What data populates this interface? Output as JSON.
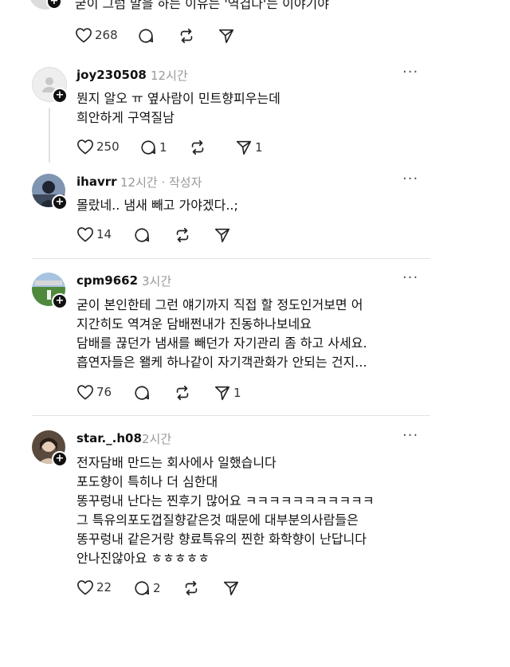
{
  "top_partial": {
    "text": "굳이 그럼 말을 하는 이유는 '역겹다'는 이야기야",
    "actions": {
      "like_count": "268"
    }
  },
  "comments": [
    {
      "username": "joy230508",
      "time": "12시간",
      "lines": [
        "뭔지 알오 ㅠ 옆사람이 민트향피우는데",
        "희안하게 구역질남"
      ],
      "actions": {
        "like_count": "250",
        "comment_count": "1",
        "share_count": "1"
      }
    },
    {
      "username": "ihavrr",
      "time": "12시간 · 작성자",
      "lines": [
        "몰랐네.. 냄새 빼고 가야겠다..;"
      ],
      "actions": {
        "like_count": "14"
      }
    },
    {
      "username": "cpm9662",
      "time": "3시간",
      "lines": [
        "굳이 본인한테 그런 얘기까지 직접 할 정도인거보면 어",
        "지간히도 역겨운 담배쩐내가 진동하나보네요",
        "담배를 끊던가 냄새를 빼던가 자기관리 좀 하고 사세요.",
        "흡연자들은 왤케 하나같이 자기객관화가 안되는 건지..."
      ],
      "actions": {
        "like_count": "76",
        "share_count": "1"
      }
    },
    {
      "username": "star._.h08",
      "time": "2시간",
      "lines": [
        "전자담배 만드는 회사에사 일했습니다",
        "포도향이 특히나 더 심한대",
        "똥꾸렁내 난다는 찐후기 많어요 ㅋㅋㅋㅋㅋㅋㅋㅋㅋㅋㅋ",
        "그 특유의포도껍질향같은것 때문에 대부분의사람들은",
        "똥꾸렁내 같은거랑 향료특유의 찐한 화학향이 난답니다",
        "안나진않아요 ㅎㅎㅎㅎㅎ"
      ],
      "actions": {
        "like_count": "22",
        "comment_count": "2"
      }
    }
  ],
  "icons": {
    "like": "heart-icon",
    "comment": "comment-bubble-icon",
    "repost": "repost-icon",
    "share": "send-icon",
    "more": "more-dots-icon",
    "follow": "plus-badge-icon"
  },
  "more_glyph": "···",
  "plus_glyph": "+",
  "colors": {
    "text": "#111111",
    "muted": "#999999",
    "divider": "#e2e2e2",
    "icon": "#222222"
  }
}
